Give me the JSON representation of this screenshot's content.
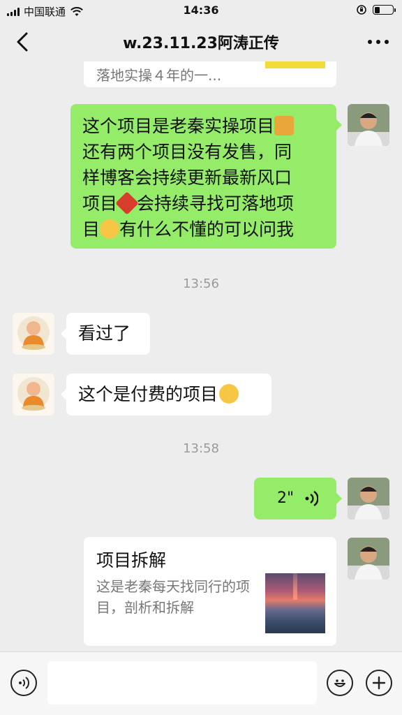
{
  "status_bar": {
    "carrier": "中国联通",
    "time": "14:36"
  },
  "header": {
    "title": "w.23.11.23阿涛正传"
  },
  "messages": {
    "partial_card_text": "落地实操４年的一...",
    "msg1": {
      "line1": "这个项目是老秦实操项目",
      "line2": "还有两个项目没有发售，同",
      "line3a": "样博客会持续更新最新风口",
      "line4a": "项目",
      "line4b": "会持续寻找可落地项",
      "line5a": "目",
      "line5b": "有什么不懂的可以问我"
    },
    "time1": "13:56",
    "msg2": "看过了",
    "msg3": "这个是付费的项目",
    "time2": "13:58",
    "voice_duration": "2\"",
    "card": {
      "title": "项目拆解",
      "desc": "这是老秦每天找同行的项目，剖析和拆解"
    }
  },
  "colors": {
    "my_bubble": "#95ec69",
    "their_bubble": "#ffffff",
    "background": "#ededed"
  }
}
